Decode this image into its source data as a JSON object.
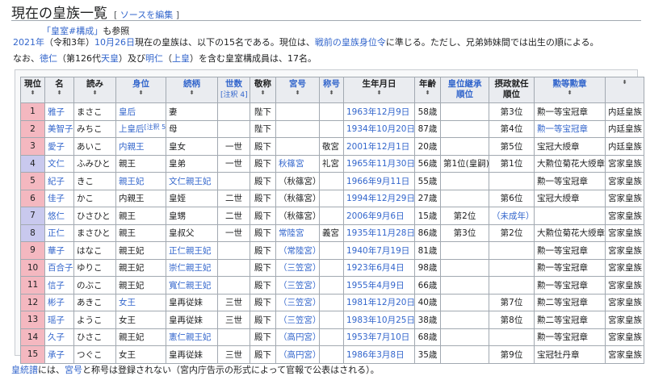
{
  "heading": {
    "title": "現在の皇族一覧",
    "edit_open": "[",
    "edit_label": "ソースを編集",
    "edit_close": "]"
  },
  "hatnote": {
    "link": "「皇室#構成」",
    "suffix": "も参照"
  },
  "intro": {
    "line1": [
      {
        "t": "2021年",
        "link": true
      },
      {
        "t": "（令和3年）",
        "link": false
      },
      {
        "t": "10月26日",
        "link": true
      },
      {
        "t": "現在の皇族は、以下の15名である。現位は、",
        "link": false
      },
      {
        "t": "戦前の皇族身位令",
        "link": true
      },
      {
        "t": "に準じる。ただし、兄弟姉妹間では出生の順による。",
        "link": false
      }
    ],
    "line2": [
      {
        "t": "なお、",
        "link": false
      },
      {
        "t": "徳仁",
        "link": true
      },
      {
        "t": "（第126代",
        "link": false
      },
      {
        "t": "天皇",
        "link": true
      },
      {
        "t": "）及び",
        "link": false
      },
      {
        "t": "明仁",
        "link": true
      },
      {
        "t": "（",
        "link": false
      },
      {
        "t": "上皇",
        "link": true
      },
      {
        "t": "）を含む皇室構成員は、17名。",
        "link": false
      }
    ]
  },
  "table": {
    "headers": [
      {
        "l": "現位",
        "link": false
      },
      {
        "l": "名",
        "link": false
      },
      {
        "l": "読み",
        "link": false
      },
      {
        "l": "身位",
        "link": true
      },
      {
        "l": "続柄",
        "link": true
      },
      {
        "l": "世数",
        "link": true,
        "note": "[注釈 4]"
      },
      {
        "l": "敬称",
        "link": false
      },
      {
        "l": "宮号",
        "link": true
      },
      {
        "l": "称号",
        "link": true
      },
      {
        "l": "生年月日",
        "link": false
      },
      {
        "l": "年齢",
        "link": false
      },
      {
        "l": "皇位継承",
        "l2": "順位",
        "link": true
      },
      {
        "l": "摂政就任",
        "l2": "順位",
        "link": false
      },
      {
        "l": "勲等勲章",
        "link": true
      },
      {
        "l": "",
        "link": false
      }
    ],
    "rows": [
      {
        "c": "pink",
        "v": [
          "1",
          "雅子",
          "まさこ",
          "皇后",
          "妻",
          "",
          "陛下",
          "",
          "",
          "1963年12月9日",
          "58歳",
          "",
          "第3位",
          "勲一等宝冠章",
          "内廷皇族"
        ]
      },
      {
        "c": "pink",
        "v": [
          "2",
          "美智子",
          "みちこ",
          "上皇后",
          "母",
          "",
          "陛下",
          "",
          "",
          "1934年10月20日",
          "87歳",
          "",
          "第4位",
          "勲一等宝冠章",
          "内廷皇族"
        ],
        "sup": "[注釈 5]"
      },
      {
        "c": "pink",
        "v": [
          "3",
          "愛子",
          "あいこ",
          "内親王",
          "皇女",
          "一世",
          "殿下",
          "",
          "敬宮",
          "2001年12月1日",
          "20歳",
          "",
          "第5位",
          "宝冠大綬章",
          "内廷皇族"
        ]
      },
      {
        "c": "lav",
        "v": [
          "4",
          "文仁",
          "ふみひと",
          "親王",
          "皇弟",
          "一世",
          "殿下",
          "秋篠宮",
          "礼宮",
          "1965年11月30日",
          "56歳",
          "第1位(皇嗣)",
          "第1位",
          "大勲位菊花大綬章",
          "宮家皇族"
        ]
      },
      {
        "c": "pink",
        "v": [
          "5",
          "紀子",
          "きこ",
          "親王妃",
          "文仁親王妃",
          "",
          "殿下",
          "（秋篠宮）",
          "",
          "1966年9月11日",
          "55歳",
          "",
          "",
          "勲一等宝冠章",
          "宮家皇族"
        ]
      },
      {
        "c": "pink",
        "v": [
          "6",
          "佳子",
          "かこ",
          "内親王",
          "皇姪",
          "二世",
          "殿下",
          "（秋篠宮）",
          "",
          "1994年12月29日",
          "27歳",
          "",
          "第6位",
          "宝冠大綬章",
          "宮家皇族"
        ]
      },
      {
        "c": "lav",
        "v": [
          "7",
          "悠仁",
          "ひさひと",
          "親王",
          "皇甥",
          "二世",
          "殿下",
          "（秋篠宮）",
          "",
          "2006年9月6日",
          "15歳",
          "第2位",
          "（未成年）",
          "",
          "宮家皇族"
        ]
      },
      {
        "c": "lav",
        "v": [
          "8",
          "正仁",
          "まさひと",
          "親王",
          "皇叔父",
          "一世",
          "殿下",
          "常陸宮",
          "義宮",
          "1935年11月28日",
          "86歳",
          "第3位",
          "第2位",
          "大勲位菊花大綬章",
          "宮家皇族"
        ]
      },
      {
        "c": "pink",
        "v": [
          "9",
          "華子",
          "はなこ",
          "親王妃",
          "正仁親王妃",
          "",
          "殿下",
          "（常陸宮）",
          "",
          "1940年7月19日",
          "81歳",
          "",
          "",
          "勲一等宝冠章",
          "宮家皇族"
        ]
      },
      {
        "c": "pink",
        "v": [
          "10",
          "百合子",
          "ゆりこ",
          "親王妃",
          "崇仁親王妃",
          "",
          "殿下",
          "（三笠宮）",
          "",
          "1923年6月4日",
          "98歳",
          "",
          "",
          "勲一等宝冠章",
          "宮家皇族"
        ]
      },
      {
        "c": "pink",
        "v": [
          "11",
          "信子",
          "のぶこ",
          "親王妃",
          "寬仁親王妃",
          "",
          "殿下",
          "（三笠宮）",
          "",
          "1955年4月9日",
          "66歳",
          "",
          "",
          "勲一等宝冠章",
          "宮家皇族"
        ]
      },
      {
        "c": "pink",
        "v": [
          "12",
          "彬子",
          "あきこ",
          "女王",
          "皇再従妹",
          "三世",
          "殿下",
          "（三笠宮）",
          "",
          "1981年12月20日",
          "40歳",
          "",
          "第7位",
          "勲二等宝冠章",
          "宮家皇族"
        ]
      },
      {
        "c": "pink",
        "v": [
          "13",
          "瑶子",
          "ようこ",
          "女王",
          "皇再従妹",
          "三世",
          "殿下",
          "（三笠宮）",
          "",
          "1983年10月25日",
          "38歳",
          "",
          "第8位",
          "勲二等宝冠章",
          "宮家皇族"
        ]
      },
      {
        "c": "pink",
        "v": [
          "14",
          "久子",
          "ひさこ",
          "親王妃",
          "憲仁親王妃",
          "",
          "殿下",
          "（高円宮）",
          "",
          "1953年7月10日",
          "68歳",
          "",
          "",
          "勲一等宝冠章",
          "宮家皇族"
        ]
      },
      {
        "c": "pink",
        "v": [
          "15",
          "承子",
          "つぐこ",
          "女王",
          "皇再従妹",
          "三世",
          "殿下",
          "（高円宮）",
          "",
          "1986年3月8日",
          "35歳",
          "",
          "第9位",
          "宝冠牡丹章",
          "宮家皇族"
        ]
      }
    ],
    "links": {
      "1": [
        1,
        3,
        9
      ],
      "2": [
        1,
        3,
        9,
        13
      ],
      "3": [
        1,
        3,
        9
      ],
      "4": [
        1,
        7,
        9
      ],
      "5": [
        1,
        3,
        4,
        9
      ],
      "6": [
        1,
        9
      ],
      "7": [
        1,
        9,
        12
      ],
      "8": [
        1,
        7,
        9
      ],
      "9": [
        1,
        4,
        7,
        9
      ],
      "10": [
        1,
        4,
        7,
        9
      ],
      "11": [
        1,
        4,
        7,
        9
      ],
      "12": [
        1,
        3,
        7,
        9
      ],
      "13": [
        1,
        7,
        9
      ],
      "14": [
        1,
        4,
        7,
        9
      ],
      "15": [
        1,
        7,
        9
      ]
    }
  },
  "footer": [
    {
      "t": "皇統譜",
      "link": true
    },
    {
      "t": "には、",
      "link": false
    },
    {
      "t": "宮号",
      "link": true
    },
    {
      "t": "と称号は登録されない（宮内庁告示の形式によって官報で公表はされる）。",
      "link": false
    }
  ],
  "sort_glyph": "⬍"
}
